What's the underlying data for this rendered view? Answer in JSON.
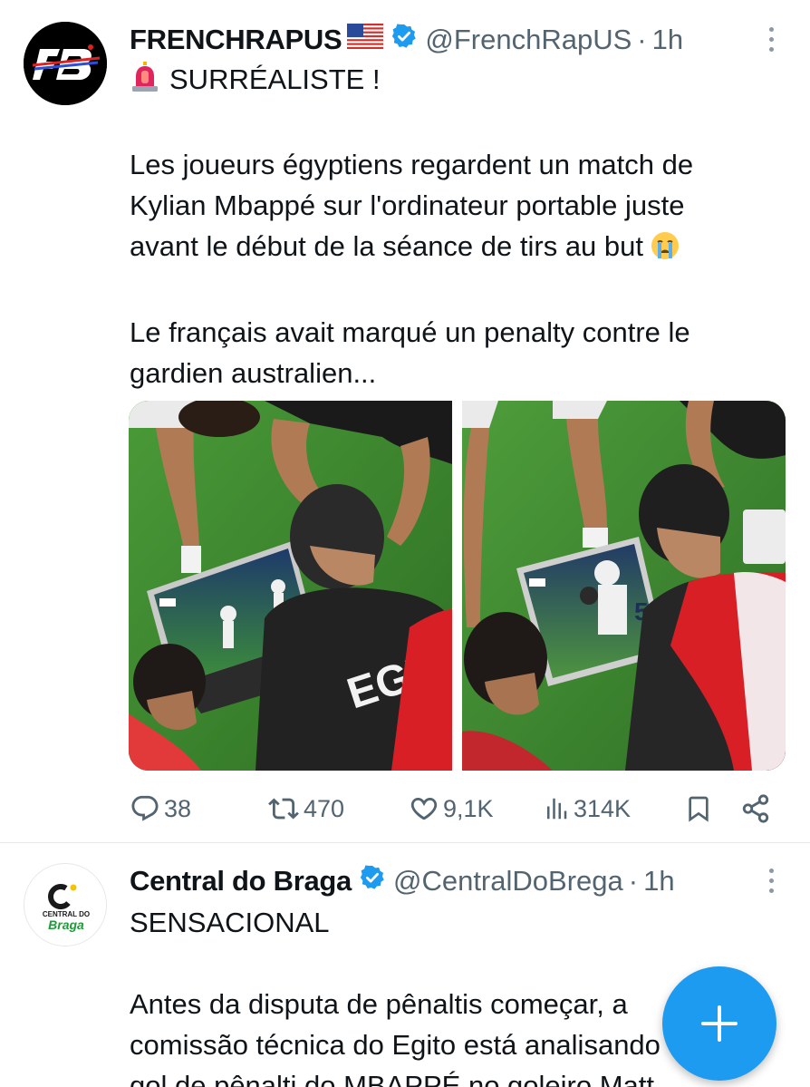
{
  "tweets": [
    {
      "name": "FRENCHRAPUS",
      "handle": "@FrenchRapUS",
      "time": "1h",
      "headline": "SURRÉALISTE !",
      "para1": [
        "Les joueurs égyptiens regardent un match de",
        "Kylian Mbappé sur l'ordinateur portable juste",
        "avant le début de la séance de tirs au but"
      ],
      "para2": [
        "Le français avait marqué un penalty contre le",
        "gardien australien..."
      ],
      "photo1_jersey": "EGYPT",
      "photo2_number": "5",
      "stats": {
        "replies": "38",
        "reposts": "470",
        "likes": "9,1K",
        "views": "314K"
      }
    },
    {
      "name": "Central do Braga",
      "handle": "@CentralDoBrega",
      "time": "1h",
      "avatar_text": [
        "C",
        "CENTRAL DO",
        "Braga"
      ],
      "headline": "SENSACIONAL",
      "para1": [
        "Antes da disputa de pênaltis começar, a",
        "comissão técnica do Egito está analisando o",
        "gol de pênalti do MBAPPÉ no goleiro Matt"
      ]
    }
  ],
  "icons": {
    "verified": "verified-badge-icon",
    "flag": "us-flag-icon",
    "siren": "siren-icon",
    "cry": "crying-face-icon",
    "compose": "plus-icon"
  },
  "colors": {
    "accent": "#1d9bf0",
    "muted": "#536471",
    "text": "#0f1419"
  }
}
